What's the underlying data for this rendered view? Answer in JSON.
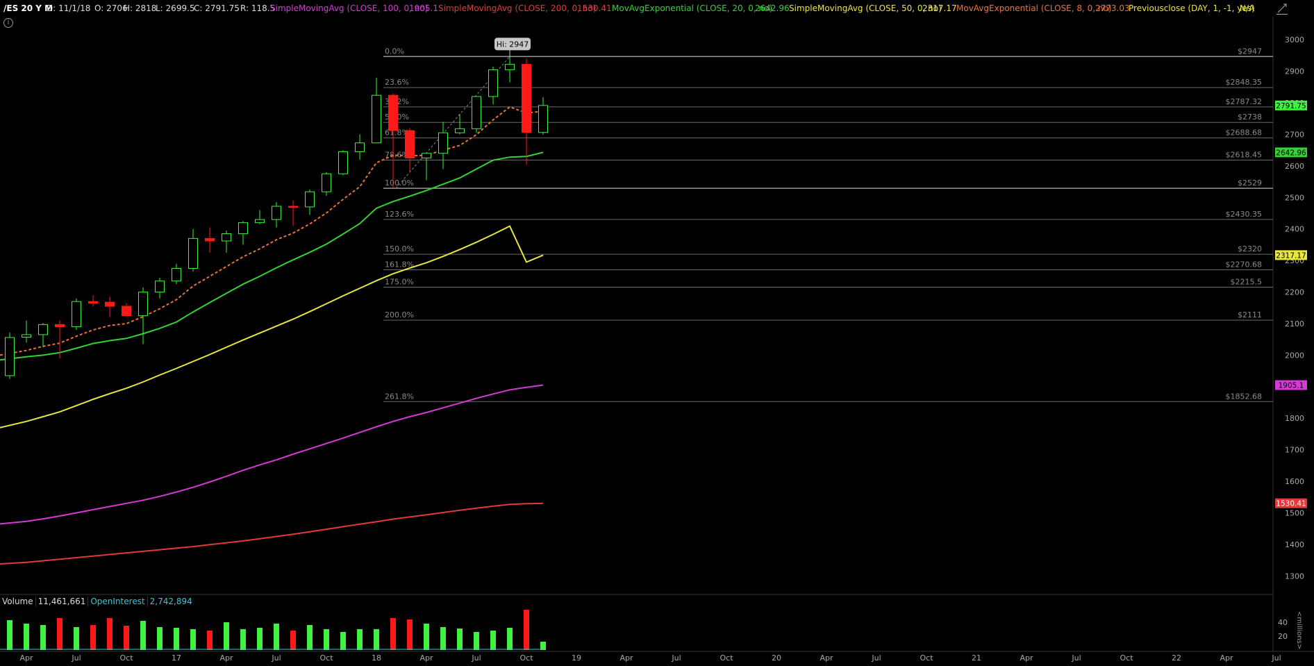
{
  "header": {
    "symbol": "/ES 20 Y M",
    "date": "D: 11/1/18",
    "open": "O: 2706",
    "high": "H: 2818",
    "low": "L: 2699.5",
    "close": "C: 2791.75",
    "range": "R: 118.5",
    "studies": [
      {
        "label": "SimpleMovingAvg (CLOSE, 100, 0, no)",
        "value": "1905.1",
        "color": "#d63ad6"
      },
      {
        "label": "SimpleMovingAvg (CLOSE, 200, 0, no)",
        "value": "1530.41",
        "color": "#e23a3a"
      },
      {
        "label": "MovAvgExponential (CLOSE, 20, 0, no)",
        "value": "2642.96",
        "color": "#34d234"
      },
      {
        "label": "SimpleMovingAvg (CLOSE, 50, 0, no)",
        "value": "2317.17",
        "color": "#e8e83a"
      },
      {
        "label": "MovAvgExponential (CLOSE, 8, 0, no)",
        "value": "2773.03",
        "color": "#e8753a"
      },
      {
        "label": "Previousclose (DAY, 1, -1, yes)",
        "value": "N/A",
        "color": "#e8e83a"
      }
    ]
  },
  "icons": {
    "info": "info-icon",
    "corner": "draw-tool-icon",
    "info_glyph": "i"
  },
  "colors": {
    "up": "#3ef23e",
    "down": "#ff1a1a",
    "grid": "#3a3a3a",
    "fib": "#6a6a6a"
  },
  "chart_data": {
    "type": "candlestick",
    "ylim": [
      1250,
      3060
    ],
    "y_ticks": [
      1300,
      1400,
      1500,
      1600,
      1700,
      1800,
      1900,
      2000,
      2100,
      2200,
      2300,
      2400,
      2500,
      2600,
      2700,
      2800,
      2900,
      3000
    ],
    "x_labels": [
      "Apr",
      "Jul",
      "Oct",
      "17",
      "Apr",
      "Jul",
      "Oct",
      "18",
      "Apr",
      "Jul",
      "Oct",
      "19",
      "Apr",
      "Jul",
      "Oct",
      "20",
      "Apr",
      "Jul",
      "Oct",
      "21",
      "Apr",
      "Jul",
      "Oct",
      "22",
      "Apr",
      "Jul"
    ],
    "x_label_slots": [
      1,
      4,
      7,
      10,
      13,
      16,
      19,
      22,
      25,
      28,
      31,
      34,
      37,
      40,
      43,
      46,
      49,
      52,
      55,
      58,
      61,
      64,
      67,
      70,
      73,
      76
    ],
    "candles": [
      {
        "o": 1935,
        "h": 2072,
        "l": 1925,
        "c": 2056
      },
      {
        "o": 2057,
        "h": 2110,
        "l": 2040,
        "c": 2065
      },
      {
        "o": 2065,
        "h": 2102,
        "l": 2025,
        "c": 2097
      },
      {
        "o": 2097,
        "h": 2110,
        "l": 1990,
        "c": 2090
      },
      {
        "o": 2090,
        "h": 2180,
        "l": 2080,
        "c": 2170
      },
      {
        "o": 2170,
        "h": 2190,
        "l": 2155,
        "c": 2165
      },
      {
        "o": 2168,
        "h": 2185,
        "l": 2120,
        "c": 2155
      },
      {
        "o": 2155,
        "h": 2165,
        "l": 2120,
        "c": 2125
      },
      {
        "o": 2125,
        "h": 2215,
        "l": 2035,
        "c": 2200
      },
      {
        "o": 2200,
        "h": 2245,
        "l": 2180,
        "c": 2235
      },
      {
        "o": 2235,
        "h": 2290,
        "l": 2225,
        "c": 2275
      },
      {
        "o": 2275,
        "h": 2400,
        "l": 2265,
        "c": 2370
      },
      {
        "o": 2370,
        "h": 2405,
        "l": 2325,
        "c": 2362
      },
      {
        "o": 2362,
        "h": 2395,
        "l": 2325,
        "c": 2385
      },
      {
        "o": 2385,
        "h": 2425,
        "l": 2350,
        "c": 2420
      },
      {
        "o": 2420,
        "h": 2460,
        "l": 2415,
        "c": 2430
      },
      {
        "o": 2430,
        "h": 2485,
        "l": 2405,
        "c": 2472
      },
      {
        "o": 2472,
        "h": 2490,
        "l": 2410,
        "c": 2470
      },
      {
        "o": 2470,
        "h": 2525,
        "l": 2445,
        "c": 2518
      },
      {
        "o": 2518,
        "h": 2580,
        "l": 2505,
        "c": 2575
      },
      {
        "o": 2575,
        "h": 2650,
        "l": 2570,
        "c": 2645
      },
      {
        "o": 2645,
        "h": 2700,
        "l": 2620,
        "c": 2673
      },
      {
        "o": 2673,
        "h": 2880,
        "l": 2672,
        "c": 2824
      },
      {
        "o": 2824,
        "h": 2830,
        "l": 2530,
        "c": 2712
      },
      {
        "o": 2712,
        "h": 2720,
        "l": 2580,
        "c": 2625
      },
      {
        "o": 2625,
        "h": 2640,
        "l": 2555,
        "c": 2640
      },
      {
        "o": 2640,
        "h": 2740,
        "l": 2590,
        "c": 2705
      },
      {
        "o": 2705,
        "h": 2765,
        "l": 2700,
        "c": 2718
      },
      {
        "o": 2718,
        "h": 2800,
        "l": 2705,
        "c": 2820
      },
      {
        "o": 2820,
        "h": 2915,
        "l": 2795,
        "c": 2905
      },
      {
        "o": 2905,
        "h": 2947,
        "l": 2865,
        "c": 2922
      },
      {
        "o": 2922,
        "h": 2940,
        "l": 2603,
        "c": 2706
      },
      {
        "o": 2706,
        "h": 2818,
        "l": 2699.5,
        "c": 2791.75
      }
    ],
    "series": [
      {
        "name": "MovAvgExponential (CLOSE, 8, 0, no)",
        "color": "#e8753a",
        "dashed": true,
        "values": [
          2000,
          2015,
          2028,
          2038,
          2060,
          2080,
          2094,
          2100,
          2122,
          2147,
          2176,
          2219,
          2250,
          2281,
          2312,
          2337,
          2366,
          2387,
          2416,
          2451,
          2494,
          2534,
          2610,
          2634,
          2632,
          2634,
          2650,
          2665,
          2699,
          2746,
          2787,
          2768,
          2773
        ]
      },
      {
        "name": "MovAvgExponential (CLOSE, 20, 0, no)",
        "color": "#34d234",
        "dashed": false,
        "values": [
          1985,
          1995,
          2000,
          2008,
          2022,
          2037,
          2046,
          2053,
          2068,
          2085,
          2105,
          2137,
          2167,
          2196,
          2225,
          2250,
          2277,
          2302,
          2326,
          2352,
          2384,
          2417,
          2466,
          2487,
          2504,
          2522,
          2542,
          2562,
          2590,
          2618,
          2628,
          2630,
          2642.96
        ]
      },
      {
        "name": "SimpleMovingAvg (CLOSE, 50, 0, no)",
        "color": "#e8e83a",
        "dashed": false,
        "values": [
          1770,
          1790,
          1805,
          1820,
          1840,
          1860,
          1878,
          1895,
          1915,
          1937,
          1958,
          1980,
          2002,
          2025,
          2048,
          2070,
          2092,
          2114,
          2138,
          2163,
          2188,
          2212,
          2236,
          2258,
          2276,
          2293,
          2313,
          2335,
          2358,
          2383,
          2409,
          2295,
          2317.17
        ]
      },
      {
        "name": "SimpleMovingAvg (CLOSE, 100, 0, no)",
        "color": "#d63ad6",
        "dashed": false,
        "values": [
          1465,
          1473,
          1481,
          1490,
          1500,
          1510,
          1520,
          1530,
          1540,
          1552,
          1566,
          1581,
          1598,
          1616,
          1635,
          1652,
          1668,
          1686,
          1703,
          1720,
          1737,
          1755,
          1773,
          1790,
          1805,
          1818,
          1833,
          1848,
          1863,
          1877,
          1890,
          1898,
          1905.1
        ]
      },
      {
        "name": "SimpleMovingAvg (CLOSE, 200, 0, no)",
        "color": "#e23a3a",
        "dashed": false,
        "values": [
          1338,
          1343,
          1348,
          1353,
          1358,
          1363,
          1368,
          1373,
          1378,
          1383,
          1388,
          1393,
          1399,
          1405,
          1411,
          1418,
          1425,
          1432,
          1440,
          1448,
          1456,
          1464,
          1472,
          1480,
          1487,
          1494,
          1501,
          1508,
          1515,
          1521,
          1527,
          1529,
          1530.41
        ]
      }
    ],
    "fib_levels": [
      {
        "pct": "0.0%",
        "price": 2947,
        "label": "$2947"
      },
      {
        "pct": "23.6%",
        "price": 2848.35,
        "label": "$2848.35"
      },
      {
        "pct": "38.2%",
        "price": 2787.32,
        "label": "$2787.32"
      },
      {
        "pct": "50.0%",
        "price": 2738,
        "label": "$2738"
      },
      {
        "pct": "61.8%",
        "price": 2688.68,
        "label": "$2688.68"
      },
      {
        "pct": "78.6%",
        "price": 2618.45,
        "label": "$2618.45"
      },
      {
        "pct": "100.0%",
        "price": 2529,
        "label": "$2529"
      },
      {
        "pct": "123.6%",
        "price": 2430.35,
        "label": "$2430.35"
      },
      {
        "pct": "150.0%",
        "price": 2320,
        "label": "$2320"
      },
      {
        "pct": "161.8%",
        "price": 2270.68,
        "label": "$2270.68"
      },
      {
        "pct": "175.0%",
        "price": 2215.5,
        "label": "$2215.5"
      },
      {
        "pct": "200.0%",
        "price": 2111,
        "label": "$2111"
      },
      {
        "pct": "261.8%",
        "price": 1852.68,
        "label": "$1852.68"
      }
    ],
    "price_tags": [
      {
        "value": 2791.75,
        "text": "2791.75",
        "bg": "#3ef23e",
        "fg": "#000"
      },
      {
        "value": 2642.96,
        "text": "2642.96",
        "bg": "#34d234",
        "fg": "#000"
      },
      {
        "value": 2317.17,
        "text": "2317.17",
        "bg": "#e8e83a",
        "fg": "#000"
      },
      {
        "value": 1905.1,
        "text": "1905.1",
        "bg": "#d63ad6",
        "fg": "#000"
      },
      {
        "value": 1530.41,
        "text": "1530.41",
        "bg": "#e23a3a",
        "fg": "#fff"
      }
    ],
    "hi_callout": {
      "text": "Hi: 2947",
      "value": 2947,
      "candle": 30
    },
    "volume": {
      "ylim": [
        0,
        60
      ],
      "y_ticks": [
        20,
        40
      ],
      "values": [
        43,
        38,
        36,
        46,
        33,
        36,
        46,
        35,
        42,
        33,
        32,
        30,
        28,
        40,
        30,
        32,
        38,
        28,
        36,
        30,
        26,
        30,
        30,
        46,
        44,
        38,
        33,
        31,
        26,
        28,
        32,
        58,
        12
      ],
      "label": "Volume",
      "value_text": "11,461,661",
      "oi_label": "OpenInterest",
      "oi_value": "2,742,894",
      "unit": "<millions>"
    }
  }
}
